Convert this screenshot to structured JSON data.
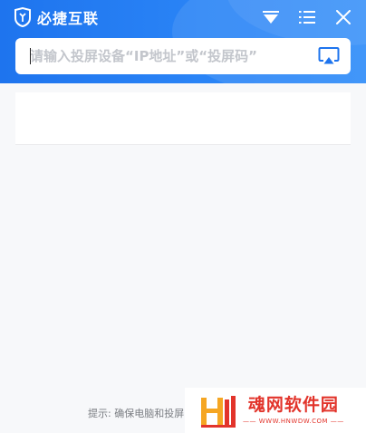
{
  "header": {
    "app_title": "必捷互联"
  },
  "search": {
    "placeholder": "请输入投屏设备“IP地址”或“投屏码”"
  },
  "footer": {
    "tip": "提示: 确保电脑和投屏"
  },
  "watermark": {
    "title": "魂网软件园",
    "url": "—— WWW.HNWDW.COM ——"
  },
  "colors": {
    "header": "#2a84f6",
    "accent": "#1e74ee",
    "watermark": "#e2342b"
  },
  "icons": {
    "logo": "shield-logo-icon",
    "dropdown": "triangle-down-icon",
    "menu": "list-menu-icon",
    "close": "close-icon",
    "cast": "screen-cast-icon"
  }
}
